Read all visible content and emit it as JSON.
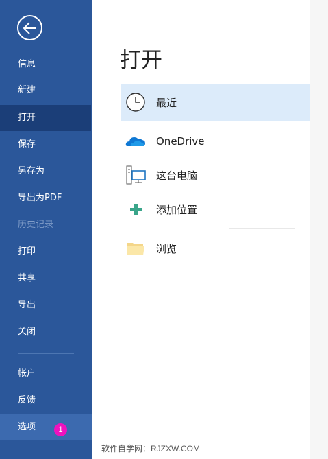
{
  "sidebar": {
    "items": [
      {
        "label": "信息"
      },
      {
        "label": "新建"
      },
      {
        "label": "打开"
      },
      {
        "label": "保存"
      },
      {
        "label": "另存为"
      },
      {
        "label": "导出为PDF"
      },
      {
        "label": "历史记录"
      },
      {
        "label": "打印"
      },
      {
        "label": "共享"
      },
      {
        "label": "导出"
      },
      {
        "label": "关闭"
      },
      {
        "label": "帐户"
      },
      {
        "label": "反馈"
      },
      {
        "label": "选项"
      }
    ],
    "selected": "打开",
    "disabled": "历史记录",
    "badge": "1"
  },
  "main": {
    "title": "打开",
    "locations": [
      {
        "label": "最近",
        "icon": "clock-icon"
      },
      {
        "label": "OneDrive",
        "icon": "onedrive-cloud-icon"
      },
      {
        "label": "这台电脑",
        "icon": "computer-icon"
      },
      {
        "label": "添加位置",
        "icon": "plus-icon"
      },
      {
        "label": "浏览",
        "icon": "folder-icon"
      }
    ]
  },
  "watermark": "软件自学网：RJZXW.COM",
  "colors": {
    "sidebar_bg": "#2b579a",
    "sidebar_selected": "#1b3e78",
    "location_selected": "#dcebfa",
    "badge": "#f012be"
  }
}
